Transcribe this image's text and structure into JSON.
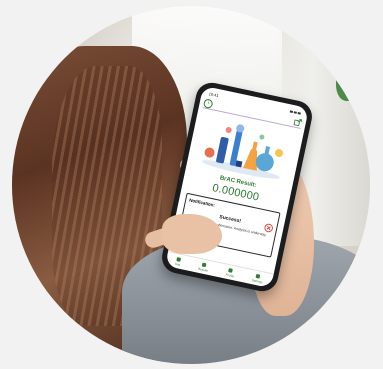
{
  "status_bar": {
    "time": "10:41"
  },
  "result": {
    "label": "BrAC Result:",
    "value": "0.000000"
  },
  "notification": {
    "title": "Notification:",
    "status": "Success!",
    "message": "Thank you for your submission. Analysis is underway."
  },
  "bottom_nav": [
    {
      "label": "Test"
    },
    {
      "label": "Results"
    },
    {
      "label": "Profile"
    },
    {
      "label": "Settings"
    }
  ],
  "colors": {
    "accent_green": "#2e7d32",
    "close_red": "#e53935",
    "toolbar_rule": "#b9a7d6"
  },
  "icons": {
    "info": "info-icon",
    "share": "share-icon",
    "close": "close-circle-icon"
  }
}
